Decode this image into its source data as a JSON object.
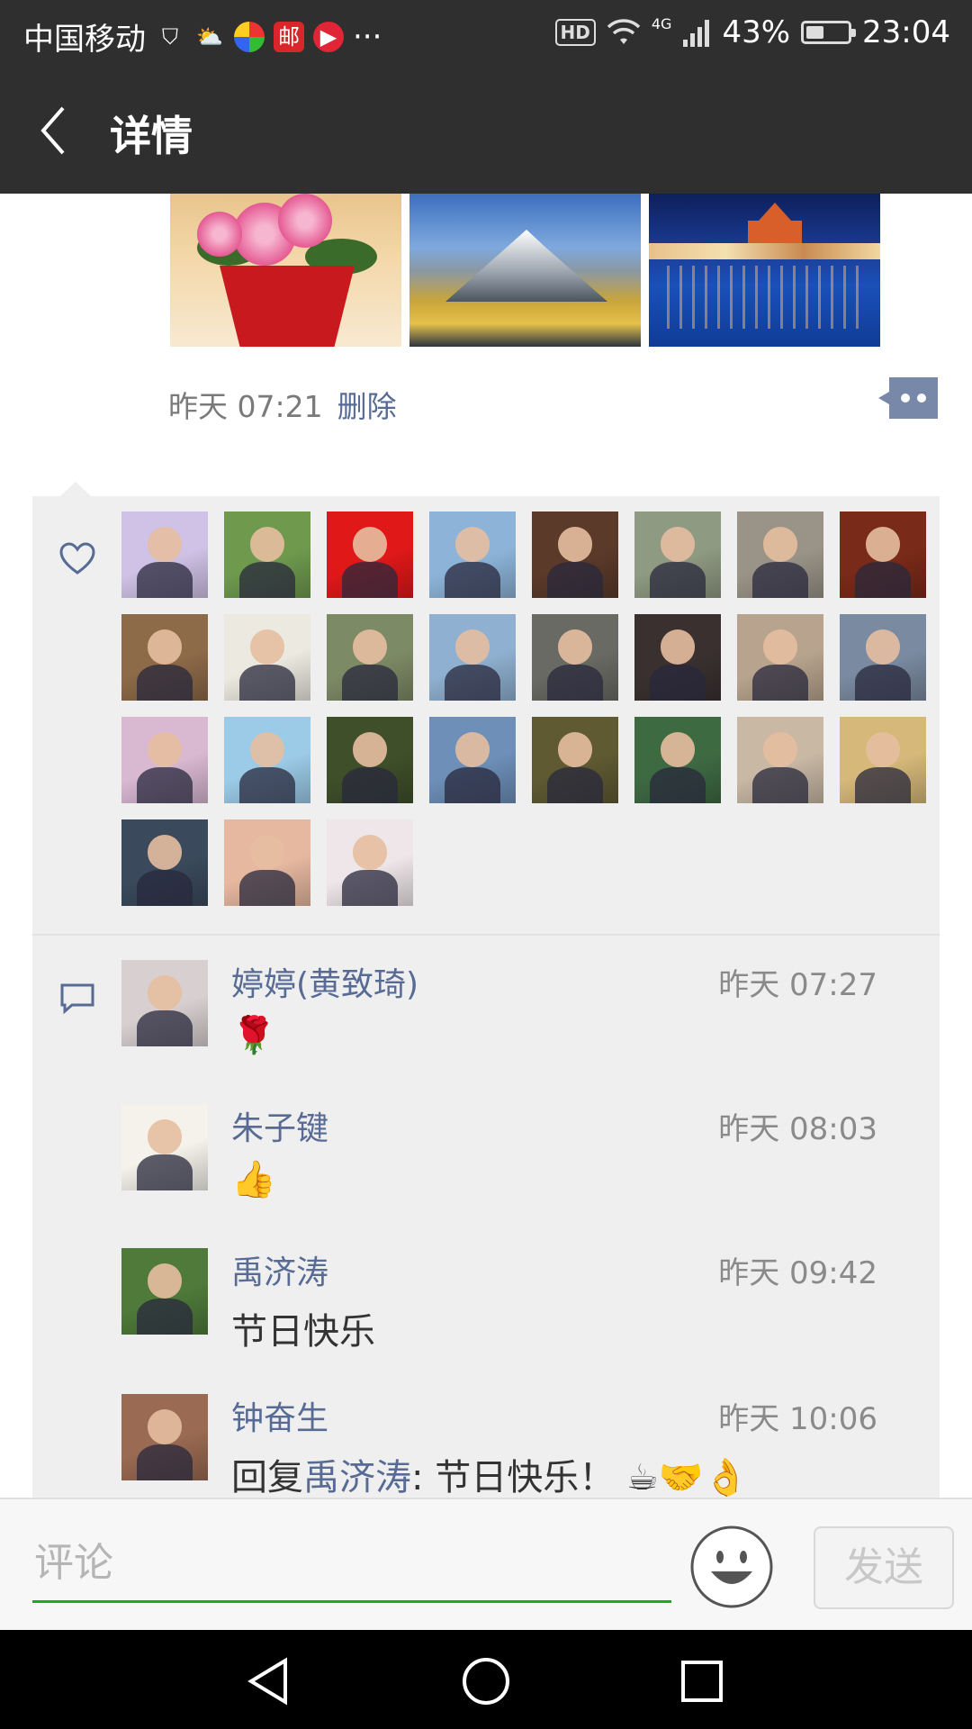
{
  "status_bar": {
    "carrier": "中国移动",
    "hd": "HD",
    "network": "4G",
    "battery": "43%",
    "battery_level": 0.43,
    "time": "23:04"
  },
  "header": {
    "title": "详情"
  },
  "post": {
    "time": "昨天 07:21",
    "delete_label": "删除"
  },
  "likes": {
    "avatar_colors": [
      "#cfc2e6",
      "#6f9a4e",
      "#e01818",
      "#8db4d8",
      "#5b3a2a",
      "#8e9a82",
      "#9a9488",
      "#7a2a18",
      "#8d6a48",
      "#eceae0",
      "#7d8a66",
      "#8fb0d0",
      "#6a6a64",
      "#3a3030",
      "#b8a48e",
      "#7a8aa0",
      "#d9b8d2",
      "#9ccbe8",
      "#3f4f2a",
      "#6d8fb8",
      "#5f5a32",
      "#3e6a42",
      "#c8b8a4",
      "#d6b87a",
      "#3a4a5c",
      "#e6b8a0",
      "#eee6e8"
    ]
  },
  "comments": [
    {
      "name": "婷婷(黄致琦)",
      "time": "昨天 07:27",
      "text": "🌹",
      "avatar_color": "#d8d0d0"
    },
    {
      "name": "朱子键",
      "time": "昨天 08:03",
      "text": "👍",
      "avatar_color": "#f4f2ea"
    },
    {
      "name": "禹济涛",
      "time": "昨天 09:42",
      "text": "节日快乐",
      "avatar_color": "#4f7a3a"
    },
    {
      "name": "钟奋生",
      "time": "昨天 10:06",
      "reply_prefix": "回复",
      "reply_to": "禹济涛",
      "text": ": 节日快乐！ ☕🤝👌",
      "avatar_color": "#9a6a52"
    }
  ],
  "comment_bar": {
    "placeholder": "评论",
    "send_label": "发送"
  },
  "colors": {
    "title_bg": "#2f2f2f",
    "link": "#576b95",
    "panel_bg": "#efefef",
    "input_underline": "#1aad19"
  }
}
